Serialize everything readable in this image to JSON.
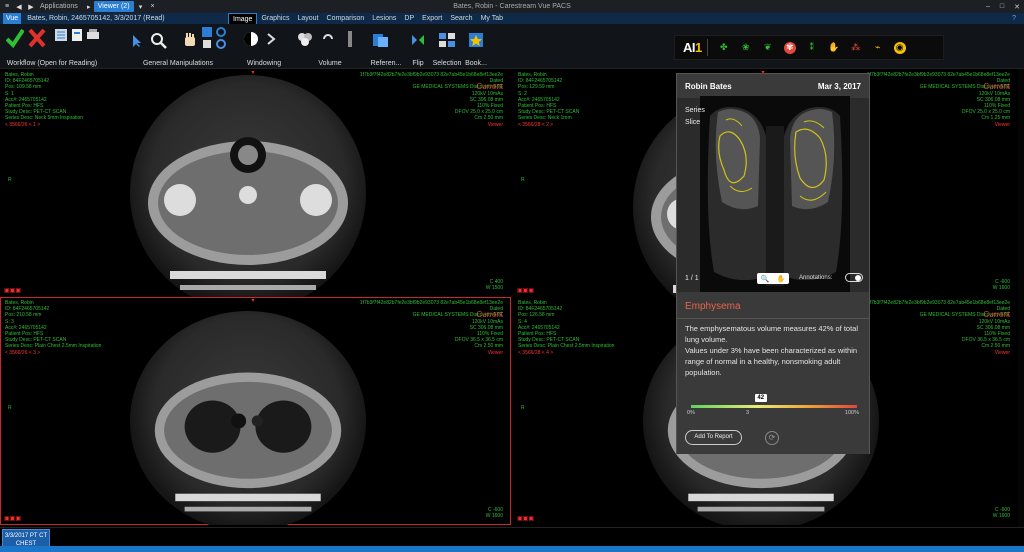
{
  "titlebar": {
    "apps": "Applications",
    "viewer": "Viewer (2)",
    "title": "Bates, Robin - Carestream Vue PACS"
  },
  "menubar": {
    "vue": "Vue",
    "patient": "Bates, Robin, 2465705142, 3/3/2017 (Read)",
    "menus": [
      "Image",
      "Graphics",
      "Layout",
      "Comparison",
      "Lesions",
      "DP",
      "Export",
      "Search",
      "My Tab"
    ],
    "active": "Image"
  },
  "ribbon": {
    "groups": [
      "Workflow (Open for Reading)",
      "General Manipulations",
      "Windowing",
      "Volume",
      "Referen...",
      "Flip",
      "Selection",
      "Book..."
    ]
  },
  "ai1": {
    "logo_a": "AI",
    "logo_b": "1"
  },
  "panes": [
    {
      "l1": "Bates, Robin",
      "l2": "ID: 84F2465705142",
      "l3": "Pos: 109.58 mm",
      "l4": "S: 1",
      "l5": "Acc#: 2465705142",
      "l6": "Patient Pos: HFS",
      "l7": "Study Desc: PET-CT SCAN",
      "l8": "Series Desc: Neck 5mm Inspiration",
      "l9": "< 3566/26 < 1 >",
      "r1": "1f7b3f7f42e82b7fe2e3bf9b2e93073 82e7ab45e1b68e8ef13ee2e",
      "r2": "Dated",
      "r3": "GE MEDICAL SYSTEMS Discovery STE",
      "r4": "120kV 10mAs",
      "r5": "SC 306.08 mm",
      "r6": "110% Fixed",
      "r7": "DFOV 25.0 x 25.0 cm",
      "r8": "Cm 2.50 mm",
      "r9": "Viewer",
      "wc": "C 400",
      "ww": "W 1500",
      "cur": "Current"
    },
    {
      "l1": "Bates, Robin",
      "l2": "ID: 84F2465705142",
      "l3": "Pos: 129.59 mm",
      "l4": "S: 2",
      "l5": "Acc#: 2465705142",
      "l6": "Patient Pos: HFS",
      "l7": "Study Desc: PET-CT SCAN",
      "l8": "Series Desc: Neck 1mm",
      "l9": "< 3566/28 < 2 >",
      "r1": "1f7b3f7f42e82b7fe2e3bf9b2e93073 82e7ab45e1b68e8ef13ee2e",
      "r2": "Dated",
      "r3": "GE MEDICAL SYSTEMS Discovery STE",
      "r4": "120kV 10mAs",
      "r5": "SC 306.08 mm",
      "r6": "110% Fixed",
      "r7": "DFOV 25.0 x 25.0 cm",
      "r8": "Cm 1.25 mm",
      "r9": "Viewer",
      "wc": "C -600",
      "ww": "W 1600",
      "cur": "Current"
    },
    {
      "l1": "Bates, Robin",
      "l2": "ID: 84F2465705142",
      "l3": "Pos: 210.58 mm",
      "l4": "S: 3",
      "l5": "Acc#: 2465705142",
      "l6": "Patient Pos: HFS",
      "l7": "Study Desc: PET-CT SCAN",
      "l8": "Series Desc: Plain Chest 2.5mm Inspiration",
      "l9": "< 3566/26 < 3 >",
      "r1": "1f7b3f7f42e82b7fe2e3bf9b2e93073 82e7ab45e1b68e8ef13ee2e",
      "r2": "Dated",
      "r3": "GE MEDICAL SYSTEMS Discovery STE",
      "r4": "120kV 10mAs",
      "r5": "SC 306.08 mm",
      "r6": "110% Fixed",
      "r7": "DFOV 36.5 x 36.5 cm",
      "r8": "Cm 2.50 mm",
      "r9": "Viewer",
      "wc": "C -600",
      "ww": "W 1600",
      "cur": "Current"
    },
    {
      "l1": "Bates, Robin",
      "l2": "ID: 84F2465705142",
      "l3": "Pos: 126.58 mm",
      "l4": "S: 4",
      "l5": "Acc#: 2465705142",
      "l6": "Patient Pos: HFS",
      "l7": "Study Desc: PET-CT SCAN",
      "l8": "Series Desc: Plain Chest 2.5mm Inspiration",
      "l9": "< 3566/28 < 4 >",
      "r1": "1f7b3f7f42e82b7fe2e3bf9b2e93073 82e7ab45e1b68e8ef13ee2e",
      "r2": "Dated",
      "r3": "GE MEDICAL SYSTEMS Discovery STE",
      "r4": "120kV 10mAs",
      "r5": "SC 306.08 mm",
      "r6": "110% Fixed",
      "r7": "DFOV 36.5 x 36.5 cm",
      "r8": "Cm 2.50 mm",
      "r9": "Viewer",
      "wc": "C -600",
      "ww": "W 1600",
      "cur": "Current"
    }
  ],
  "popup": {
    "name": "Robin Bates",
    "date": "Mar 3, 2017",
    "series": "Series",
    "slice": "Slice",
    "count": "1 / 1",
    "annotations": "Annotations:",
    "finding": "Emphysema",
    "desc1": "The emphysematous volume measures 42% of total lung volume.",
    "desc2": "Values under 3% have been characterized as within range of normal in a healthy, nonsmoking adult population.",
    "value": "42",
    "threshold": "3",
    "scale_min": "0%",
    "scale_max": "100%",
    "add": "Add To Report"
  },
  "bottom": {
    "study1": "3/3/2017 PT CT",
    "study2": "CHEST"
  }
}
